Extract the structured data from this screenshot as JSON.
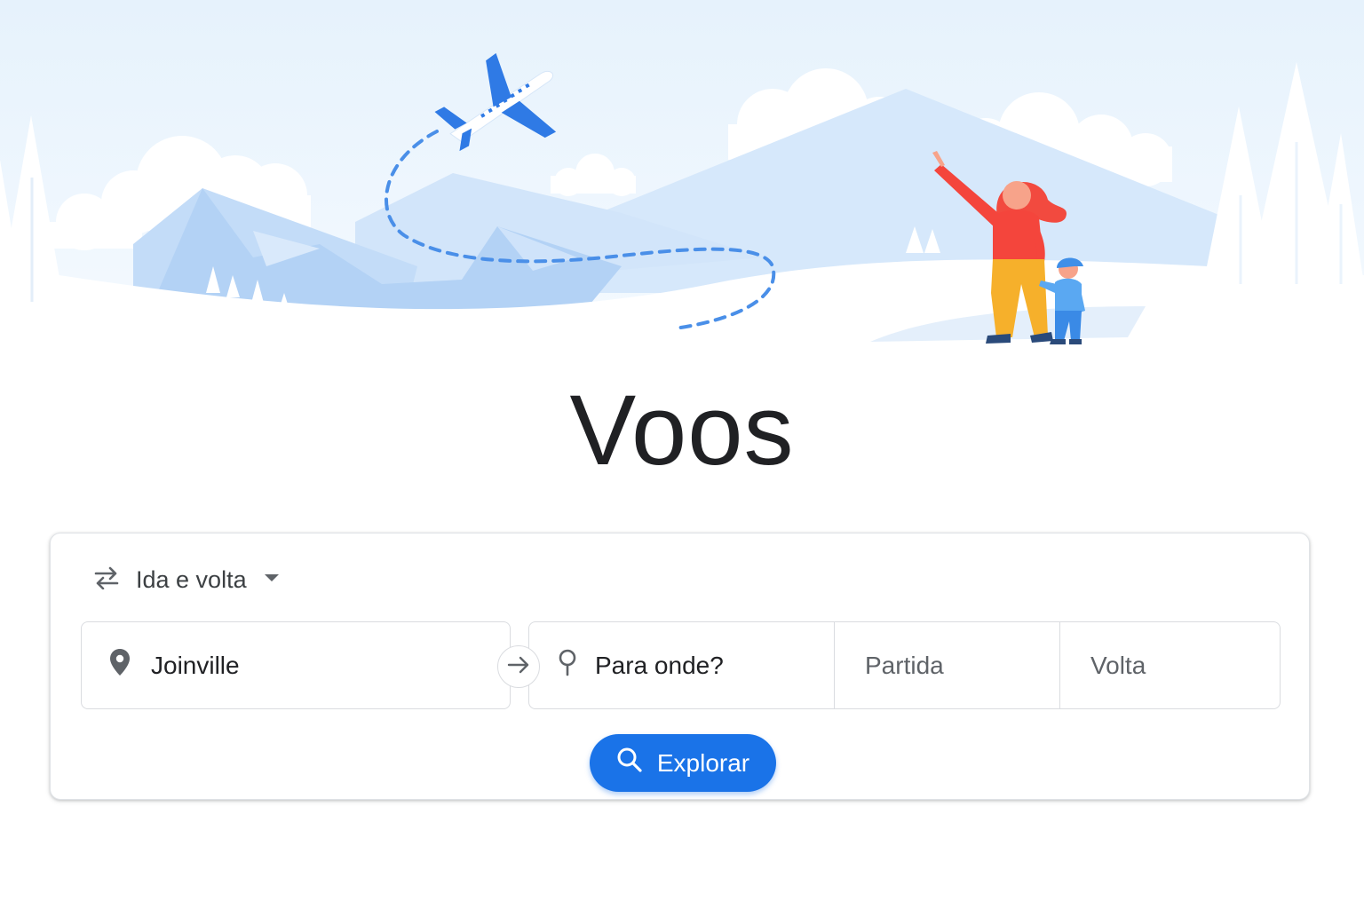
{
  "page": {
    "title": "Voos"
  },
  "search": {
    "trip_type": {
      "label": "Ida e volta",
      "icon": "swap-horiz-icon",
      "dropdown_icon": "arrow-drop-down-icon"
    },
    "origin": {
      "value": "Joinville",
      "icon": "location-pin-icon"
    },
    "swap_icon": "arrow-right-icon",
    "destination": {
      "placeholder": "Para onde?",
      "icon": "location-outline-icon"
    },
    "departure": {
      "placeholder": "Partida"
    },
    "return": {
      "placeholder": "Volta"
    },
    "explore_button": {
      "label": "Explorar",
      "icon": "search-icon"
    }
  },
  "colors": {
    "accent": "#1a73e8",
    "sky": "#e8f3fd",
    "mountain": "#b9d6f7",
    "woman_shirt": "#f4453c",
    "woman_pants": "#f6b02b",
    "child": "#4a9ef0"
  }
}
